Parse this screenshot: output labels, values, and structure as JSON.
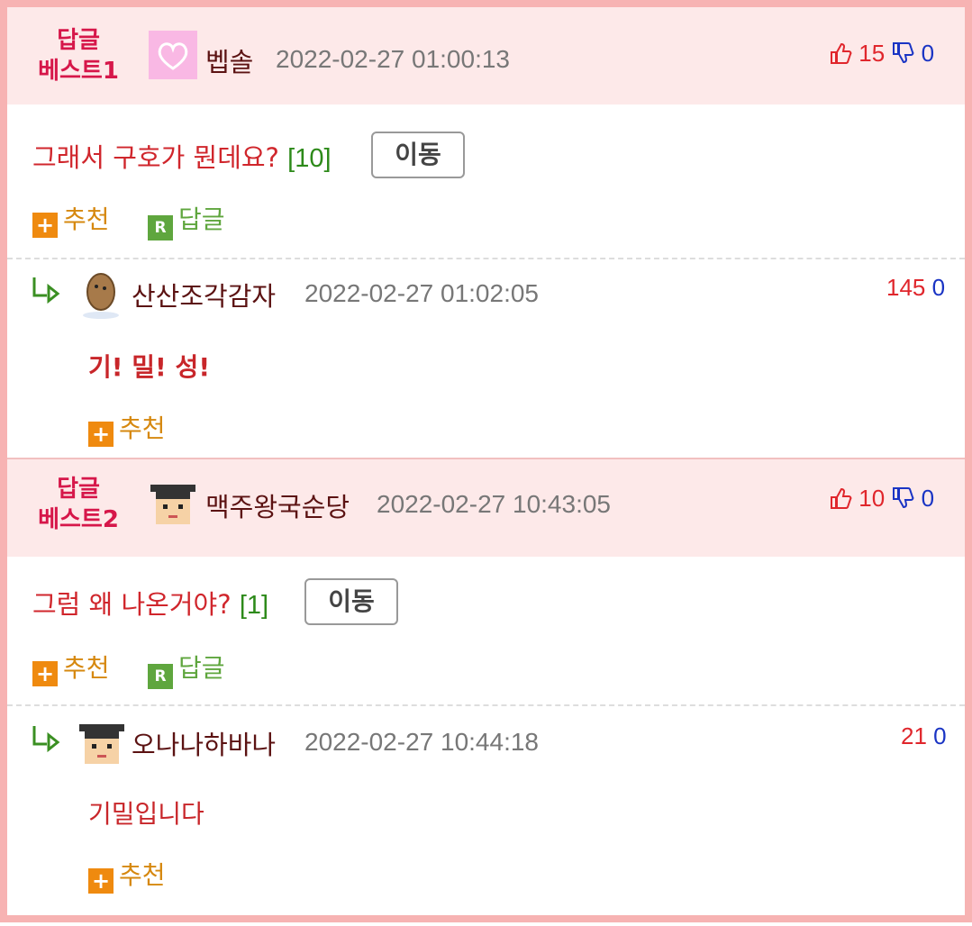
{
  "posts": [
    {
      "best_label_line1": "답글",
      "best_label_line2": "베스트1",
      "nickname": "벱솔",
      "date": "2022-02-27 01:00:13",
      "up": "15",
      "down": "0",
      "title": "그래서 구호가 뭔데요?",
      "count": "[10]",
      "move": "이동",
      "recommend": "추천",
      "reply": "답글",
      "comment": {
        "nickname": "산산조각감자",
        "date": "2022-02-27 01:02:05",
        "up": "145",
        "down": "0",
        "text": "기! 밀! 성!",
        "recommend": "추천"
      }
    },
    {
      "best_label_line1": "답글",
      "best_label_line2": "베스트2",
      "nickname": "맥주왕국순당",
      "date": "2022-02-27 10:43:05",
      "up": "10",
      "down": "0",
      "title": "그럼 왜 나온거야?",
      "count": "[1]",
      "move": "이동",
      "recommend": "추천",
      "reply": "답글",
      "comment": {
        "nickname": "오나나하바나",
        "date": "2022-02-27 10:44:18",
        "up": "21",
        "down": "0",
        "text": "기밀입니다",
        "recommend": "추천"
      }
    }
  ],
  "icons": {
    "plus": "+",
    "r": "R",
    "reply_arrow": "↳"
  }
}
